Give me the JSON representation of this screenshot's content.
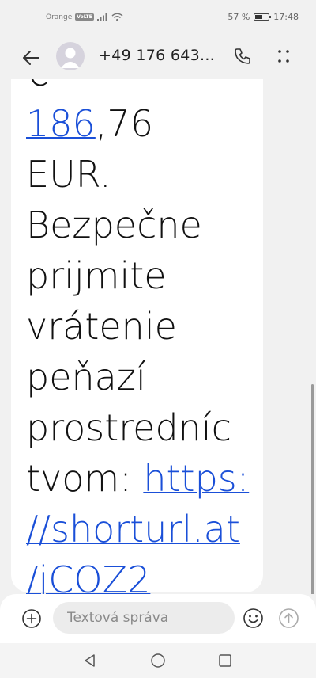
{
  "status_bar": {
    "carrier": "Orange",
    "network_badge": "VoLTE",
    "battery_percent": "57 %",
    "battery_level": 0.57,
    "time": "17:48",
    "icons": [
      "signal-icon",
      "wifi-icon",
      "battery-icon"
    ]
  },
  "header": {
    "contact": "+49 176 643...",
    "icons": [
      "back-arrow-icon",
      "contact-avatar-icon",
      "phone-icon",
      "more-dots-icon"
    ]
  },
  "message": {
    "lines": [
      {
        "text": "€",
        "link": ""
      },
      {
        "text": ",76",
        "link": "186"
      },
      {
        "text": "EUR.",
        "link": ""
      },
      {
        "text": "Bezpečne",
        "link": ""
      },
      {
        "text": "prijmite",
        "link": ""
      },
      {
        "text": "vrátenie",
        "link": ""
      },
      {
        "text": "peňazí",
        "link": ""
      },
      {
        "text": "prostredníc",
        "link": ""
      },
      {
        "text": "tvom: ",
        "link": "https:"
      },
      {
        "text": "",
        "link": "//shorturl.at"
      },
      {
        "text": "",
        "link": "/jCOZ2"
      }
    ],
    "colors": {
      "link": "#1a4fd8",
      "bubble": "#ffffff",
      "background": "#f1f1f1"
    }
  },
  "composer": {
    "placeholder": "Textová správa",
    "value": "",
    "icons": [
      "add-icon",
      "emoji-icon",
      "send-icon"
    ]
  },
  "nav_bar": {
    "icons": [
      "back-triangle-icon",
      "home-circle-icon",
      "recents-square-icon"
    ]
  }
}
